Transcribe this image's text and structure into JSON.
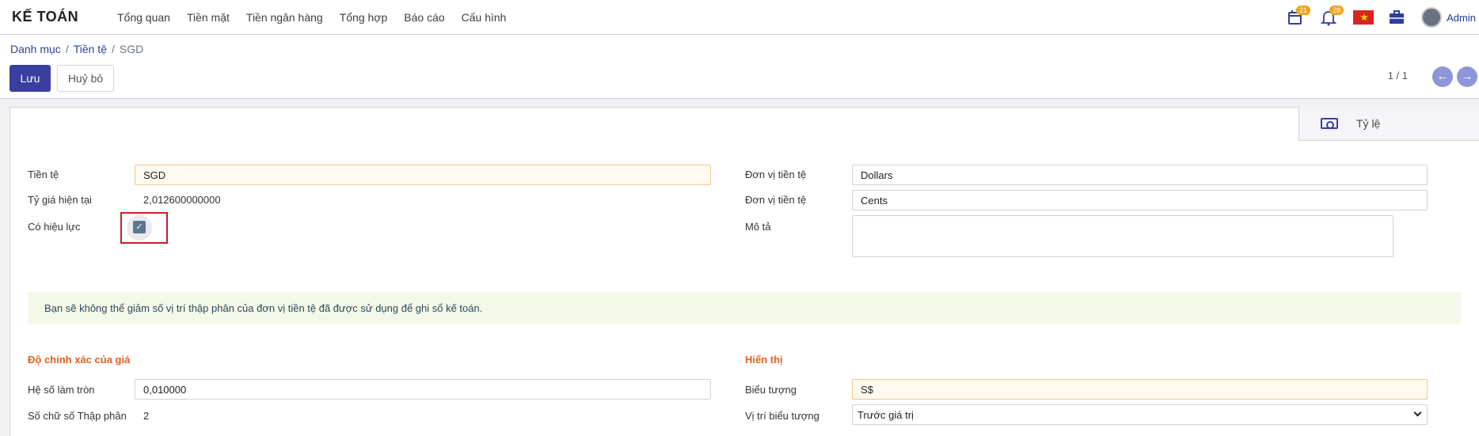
{
  "app": {
    "title": "KẾ TOÁN"
  },
  "menu": [
    "Tổng quan",
    "Tiền mặt",
    "Tiền ngân hàng",
    "Tổng hợp",
    "Báo cáo",
    "Cấu hình"
  ],
  "systray": {
    "calendar_count": "21",
    "notification_count": "28",
    "user": "Admin",
    "flag_color": "#d7261e"
  },
  "breadcrumb": {
    "root": "Danh mục",
    "parent": "Tiền tệ",
    "current": "SGD",
    "separator": "/"
  },
  "actions": {
    "save_label": "Lưu",
    "discard_label": "Huỷ bỏ"
  },
  "pager": {
    "value": "1 / 1",
    "prev_icon": "arrow-left-icon",
    "next_icon": "arrow-right-icon"
  },
  "smart_button": {
    "label": "Tỷ lệ",
    "icon": "money-icon"
  },
  "form": {
    "currency_label": "Tiền tệ",
    "currency_value": "SGD",
    "rate_label": "Tỷ giá hiện tại",
    "rate_value": "2,012600000000",
    "active_label": "Có hiệu lực",
    "active_checked": true,
    "unit_label": "Đơn vị tiền tệ",
    "unit_value": "Dollars",
    "subunit_label": "Đơn vị tiền tệ",
    "subunit_value": "Cents",
    "description_label": "Mô tả",
    "description_value": ""
  },
  "alert": {
    "text": "Bạn sẽ không thể giảm số vị trí thập phân của đơn vị tiền tệ đã được sử dụng để ghi sổ kế toán."
  },
  "precision": {
    "title": "Độ chính xác của giá",
    "rounding_label": "Hệ số làm tròn",
    "rounding_value": "0,010000",
    "decimals_label": "Số chữ số Thập phân",
    "decimals_value": "2"
  },
  "display": {
    "title": "Hiển thị",
    "symbol_label": "Biểu tượng",
    "symbol_value": "S$",
    "position_label": "Vị trí biểu tượng",
    "position_value": "Trước giá trị"
  },
  "colors": {
    "primary": "#3a3f9f",
    "section": "#e35f1f",
    "badge": "#f0a31a",
    "alert_bg": "#f4f8e8"
  }
}
